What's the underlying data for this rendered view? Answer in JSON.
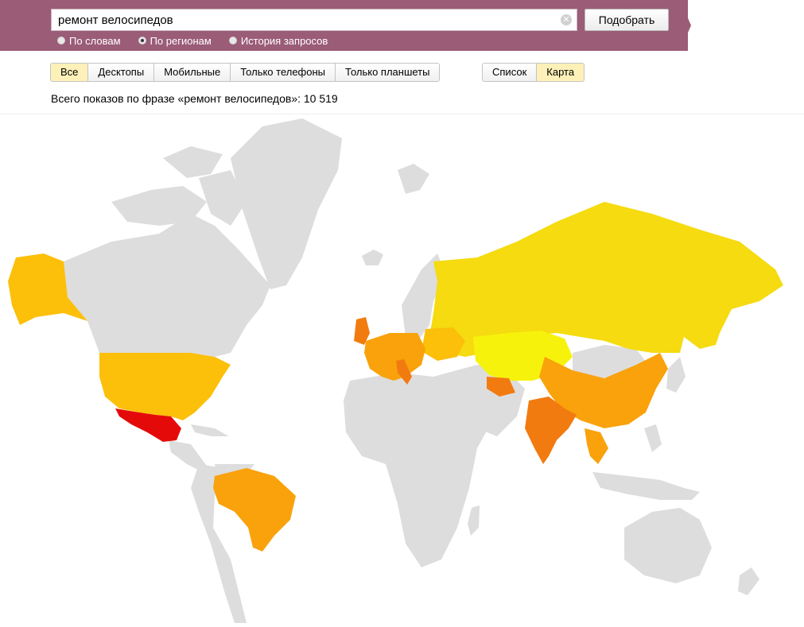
{
  "search": {
    "query": "ремонт велосипедов",
    "submit_label": "Подобрать"
  },
  "modes": [
    {
      "label": "По словам",
      "selected": false
    },
    {
      "label": "По регионам",
      "selected": true
    },
    {
      "label": "История запросов",
      "selected": false
    }
  ],
  "device_filters": [
    {
      "label": "Все",
      "active": true
    },
    {
      "label": "Десктопы",
      "active": false
    },
    {
      "label": "Мобильные",
      "active": false
    },
    {
      "label": "Только телефоны",
      "active": false
    },
    {
      "label": "Только планшеты",
      "active": false
    }
  ],
  "view_filters": [
    {
      "label": "Список",
      "active": false
    },
    {
      "label": "Карта",
      "active": true
    }
  ],
  "summary_text": "Всего показов по фразе «ремонт велосипедов»: 10 519",
  "colors": {
    "banner": "#9b5c77",
    "no_data": "#dddddd",
    "ratio_lowest": "#f7f20c",
    "ratio_low": "#f5db10",
    "ratio_mid": "#fcbf0a",
    "ratio_high": "#f9a20c",
    "ratio_higher": "#f27b10",
    "ratio_highest": "#e50a0a"
  },
  "map_regions": [
    {
      "name": "Russia",
      "level": "low"
    },
    {
      "name": "Kazakhstan",
      "level": "lowest"
    },
    {
      "name": "Alaska",
      "level": "mid"
    },
    {
      "name": "USA",
      "level": "mid"
    },
    {
      "name": "Mexico",
      "level": "highest"
    },
    {
      "name": "Brazil",
      "level": "high"
    },
    {
      "name": "India",
      "level": "higher"
    },
    {
      "name": "China",
      "level": "high"
    },
    {
      "name": "Europe",
      "level": "high"
    },
    {
      "name": "Ukraine",
      "level": "mid"
    },
    {
      "name": "Turkmenistan",
      "level": "higher"
    },
    {
      "name": "Thailand",
      "level": "high"
    }
  ]
}
